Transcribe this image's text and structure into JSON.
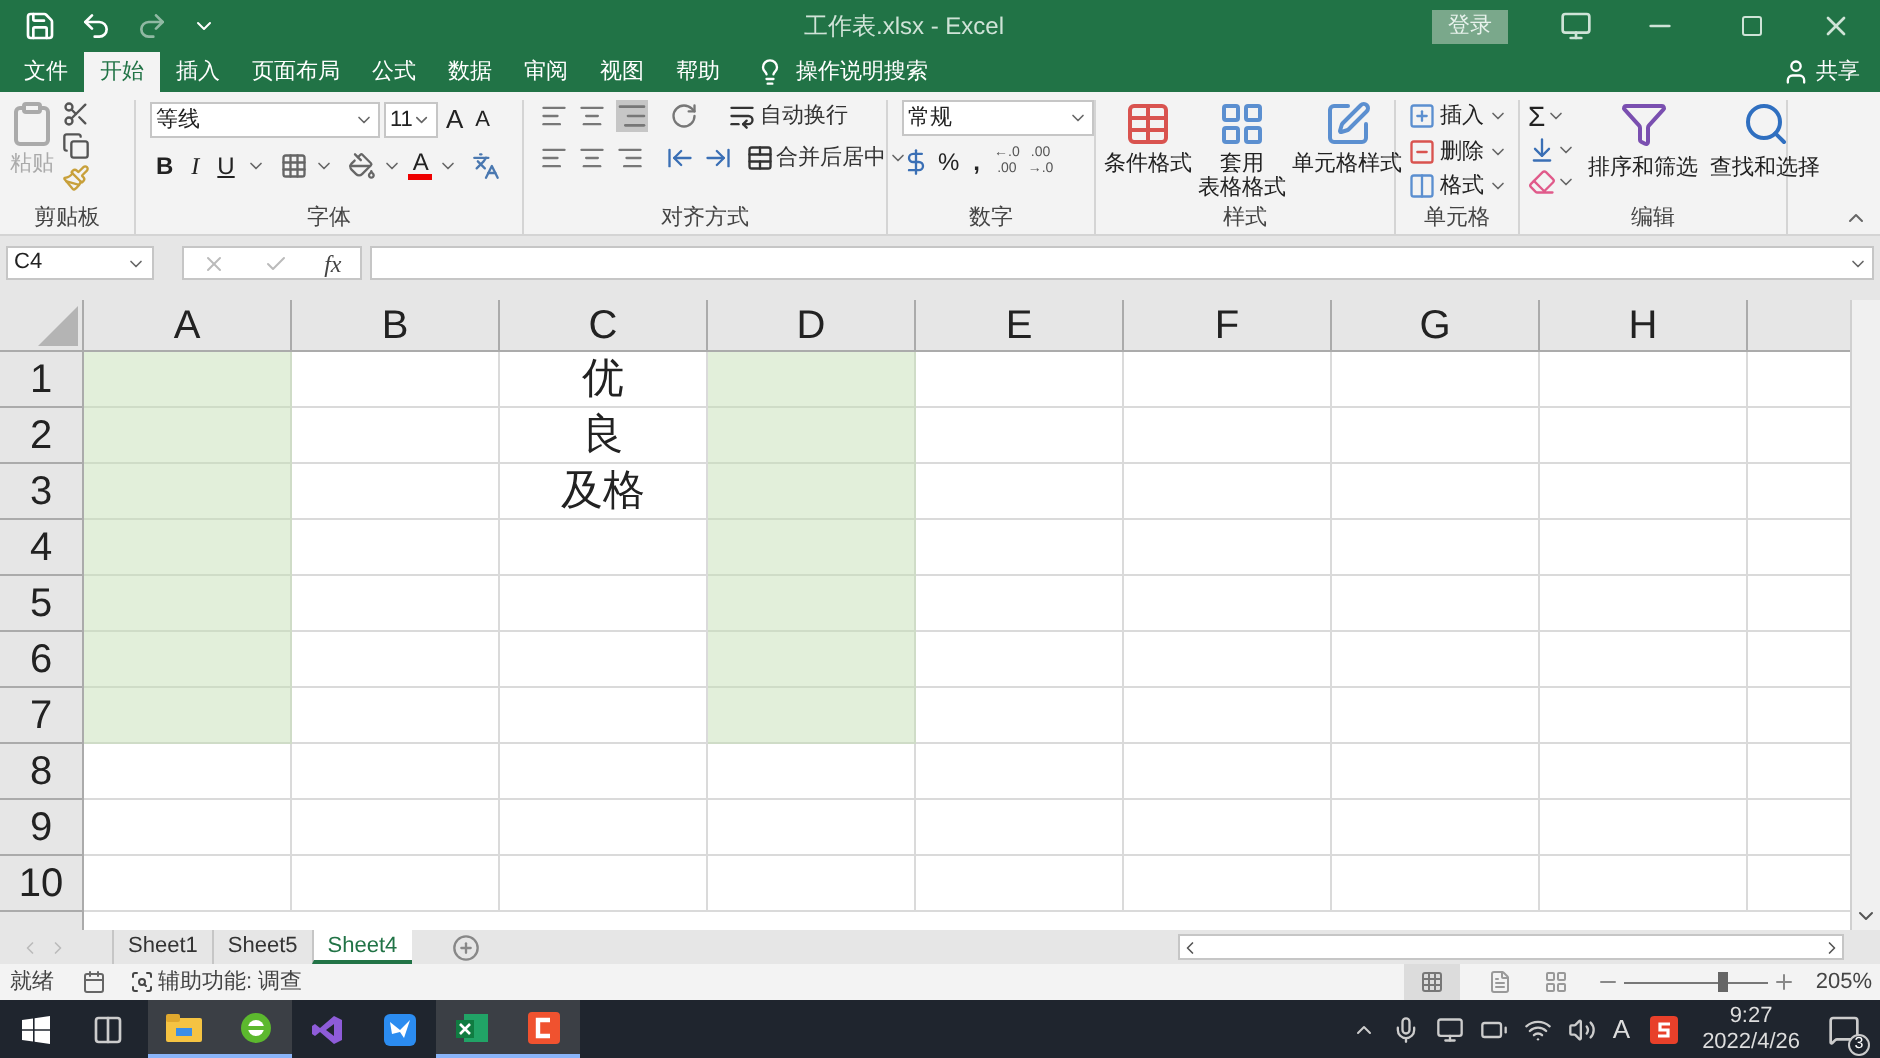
{
  "window": {
    "title": "工作表.xlsx - Excel",
    "sign_in": "登录"
  },
  "ribbon_tabs": [
    {
      "label": "文件",
      "selected": false
    },
    {
      "label": "开始",
      "selected": true
    },
    {
      "label": "插入",
      "selected": false
    },
    {
      "label": "页面布局",
      "selected": false
    },
    {
      "label": "公式",
      "selected": false
    },
    {
      "label": "数据",
      "selected": false
    },
    {
      "label": "审阅",
      "selected": false
    },
    {
      "label": "视图",
      "selected": false
    },
    {
      "label": "帮助",
      "selected": false
    }
  ],
  "tell_me": "操作说明搜索",
  "share": "共享",
  "ribbon": {
    "clipboard": {
      "label": "剪贴板",
      "paste": {
        "label": "粘贴",
        "disabled": true
      }
    },
    "font": {
      "label": "字体",
      "font_name": "等线",
      "font_size": "11",
      "grow": "A",
      "shrink": "A",
      "bold": "B",
      "italic": "I",
      "underline": "U",
      "font_color": "A"
    },
    "alignment": {
      "label": "对齐方式",
      "wrap_text": "自动换行",
      "merge": "合并后居中"
    },
    "number": {
      "label": "数字",
      "format": "常规",
      "percent": "%",
      "comma": ",",
      "increase_decimal": [
        "←.0",
        ".00"
      ],
      "decrease_decimal": [
        ".00",
        "→.0"
      ]
    },
    "styles": {
      "label": "样式",
      "conditional": "条件格式",
      "table": [
        "套用",
        "表格格式"
      ],
      "cell_styles": "单元格样式"
    },
    "cells": {
      "label": "单元格",
      "insert": "插入",
      "delete": "删除",
      "format": "格式"
    },
    "editing": {
      "label": "编辑",
      "sum": "Σ",
      "sort": "排序和筛选",
      "find": "查找和选择"
    }
  },
  "formula_bar": {
    "name_box": "C4",
    "fx": "fx"
  },
  "sheet": {
    "columns": [
      "A",
      "B",
      "C",
      "D",
      "E",
      "F",
      "G",
      "H"
    ],
    "rows": [
      {
        "header": "1",
        "cells": [
          {
            "highlighted": true
          },
          {
            "highlighted": false
          },
          {
            "text": "优",
            "highlighted": false
          },
          {
            "highlighted": true
          },
          {
            "highlighted": false
          },
          {
            "highlighted": false
          },
          {
            "highlighted": false
          },
          {
            "highlighted": false
          }
        ]
      },
      {
        "header": "2",
        "cells": [
          {
            "highlighted": true
          },
          {
            "highlighted": false
          },
          {
            "text": "良",
            "highlighted": false
          },
          {
            "highlighted": true
          },
          {
            "highlighted": false
          },
          {
            "highlighted": false
          },
          {
            "highlighted": false
          },
          {
            "highlighted": false
          }
        ]
      },
      {
        "header": "3",
        "cells": [
          {
            "highlighted": true
          },
          {
            "highlighted": false
          },
          {
            "text": "及格",
            "highlighted": false
          },
          {
            "highlighted": true
          },
          {
            "highlighted": false
          },
          {
            "highlighted": false
          },
          {
            "highlighted": false
          },
          {
            "highlighted": false
          }
        ]
      },
      {
        "header": "4",
        "cells": [
          {
            "highlighted": true
          },
          {
            "highlighted": false
          },
          {
            "highlighted": false
          },
          {
            "highlighted": true
          },
          {
            "highlighted": false
          },
          {
            "highlighted": false
          },
          {
            "highlighted": false
          },
          {
            "highlighted": false
          }
        ]
      },
      {
        "header": "5",
        "cells": [
          {
            "highlighted": true
          },
          {
            "highlighted": false
          },
          {
            "highlighted": false
          },
          {
            "highlighted": true
          },
          {
            "highlighted": false
          },
          {
            "highlighted": false
          },
          {
            "highlighted": false
          },
          {
            "highlighted": false
          }
        ]
      },
      {
        "header": "6",
        "cells": [
          {
            "highlighted": true
          },
          {
            "highlighted": false
          },
          {
            "highlighted": false
          },
          {
            "highlighted": true
          },
          {
            "highlighted": false
          },
          {
            "highlighted": false
          },
          {
            "highlighted": false
          },
          {
            "highlighted": false
          }
        ]
      },
      {
        "header": "7",
        "cells": [
          {
            "highlighted": true
          },
          {
            "highlighted": false
          },
          {
            "highlighted": false
          },
          {
            "highlighted": true
          },
          {
            "highlighted": false
          },
          {
            "highlighted": false
          },
          {
            "highlighted": false
          },
          {
            "highlighted": false
          }
        ]
      },
      {
        "header": "8",
        "cells": [
          {
            "highlighted": false
          },
          {
            "highlighted": false
          },
          {
            "highlighted": false
          },
          {
            "highlighted": false
          },
          {
            "highlighted": false
          },
          {
            "highlighted": false
          },
          {
            "highlighted": false
          },
          {
            "highlighted": false
          }
        ]
      },
      {
        "header": "9",
        "cells": [
          {
            "highlighted": false
          },
          {
            "highlighted": false
          },
          {
            "highlighted": false
          },
          {
            "highlighted": false
          },
          {
            "highlighted": false
          },
          {
            "highlighted": false
          },
          {
            "highlighted": false
          },
          {
            "highlighted": false
          }
        ]
      },
      {
        "header": "10",
        "cells": [
          {
            "highlighted": false
          },
          {
            "highlighted": false
          },
          {
            "highlighted": false
          },
          {
            "highlighted": false
          },
          {
            "highlighted": false
          },
          {
            "highlighted": false
          },
          {
            "highlighted": false
          },
          {
            "highlighted": false
          }
        ]
      }
    ]
  },
  "sheet_tabs": [
    {
      "label": "Sheet1",
      "selected": false
    },
    {
      "label": "Sheet5",
      "selected": false
    },
    {
      "label": "Sheet4",
      "selected": true
    }
  ],
  "status_bar": {
    "ready": "就绪",
    "accessibility": "辅助功能: 调查",
    "zoom": {
      "level": 0.72,
      "reading": "205%"
    }
  },
  "taskbar": {
    "ime": "A",
    "time": "9:27",
    "date": "2022/4/26",
    "notifications": "3"
  }
}
